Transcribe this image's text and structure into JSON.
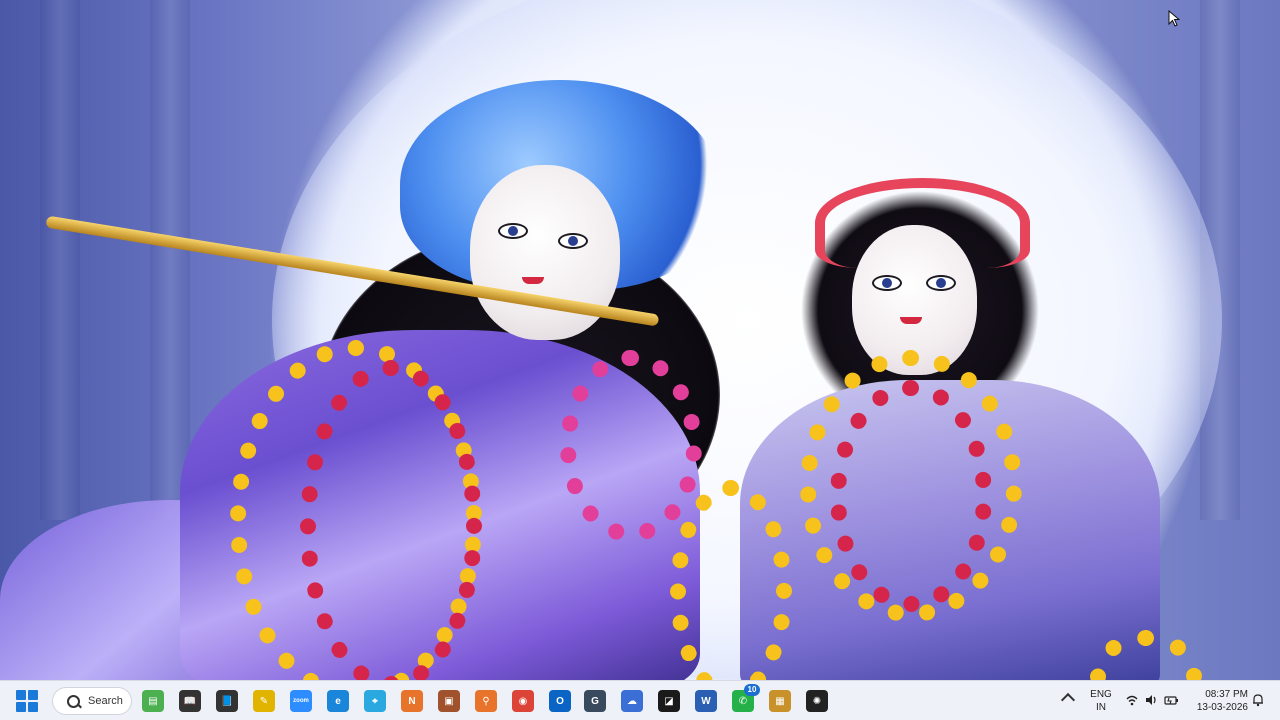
{
  "wallpaper": {
    "subject": "Radha Krishna deity wallpaper",
    "colors": {
      "background_blue": "#6c78c4",
      "halo_white": "#f3f6ff",
      "dress_purple": "#7d5ad8",
      "marigold": "#f6c21b",
      "rose_red": "#d6254a"
    }
  },
  "taskbar": {
    "start_icon": "windows-logo-icon",
    "search_label": "Search",
    "pinned_apps": [
      {
        "name": "notepad-plus-icon",
        "color": "#4caf50",
        "glyph": "▤"
      },
      {
        "name": "book-reader-icon",
        "color": "#333333",
        "glyph": "📖"
      },
      {
        "name": "book-app-icon",
        "color": "#333333",
        "glyph": "📘"
      },
      {
        "name": "yellow-pen-icon",
        "color": "#e0b400",
        "glyph": "✎"
      },
      {
        "name": "zoom-icon",
        "color": "#2d8cff",
        "glyph": "zoom"
      },
      {
        "name": "edge-icon",
        "color": "#1a86d9",
        "glyph": "e"
      },
      {
        "name": "network-tool-icon",
        "color": "#2aa9e0",
        "glyph": "⌖"
      },
      {
        "name": "orange-n-icon",
        "color": "#e8742b",
        "glyph": "N"
      },
      {
        "name": "photo-app-icon",
        "color": "#a0522d",
        "glyph": "▣"
      },
      {
        "name": "search-tool-icon",
        "color": "#e8742b",
        "glyph": "⚲"
      },
      {
        "name": "chrome-icon",
        "color": "#db4437",
        "glyph": "◉"
      },
      {
        "name": "outlook-icon",
        "color": "#0a64c6",
        "glyph": "O"
      },
      {
        "name": "g-app-icon",
        "color": "#3a4a5e",
        "glyph": "G"
      },
      {
        "name": "cloud-app-icon",
        "color": "#3b6fd6",
        "glyph": "☁"
      },
      {
        "name": "dark-app-icon",
        "color": "#1a1a1a",
        "glyph": "◪"
      },
      {
        "name": "word-icon",
        "color": "#2b5fb3",
        "glyph": "W"
      },
      {
        "name": "whatsapp-icon",
        "color": "#25b14a",
        "glyph": "✆"
      },
      {
        "name": "game-app-icon",
        "color": "#c8912a",
        "glyph": "▦"
      },
      {
        "name": "chatgpt-icon",
        "color": "#222222",
        "glyph": "✺"
      }
    ],
    "whatsapp_badge": "10",
    "tray": {
      "language_line1": "ENG",
      "language_line2": "IN",
      "time": "08:37 PM",
      "date": "13-03-2026"
    }
  }
}
